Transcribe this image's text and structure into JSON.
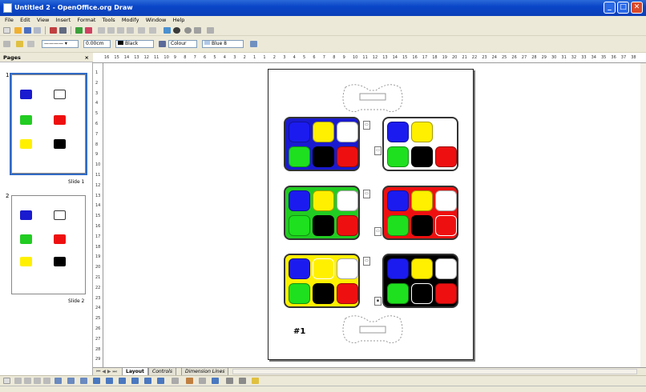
{
  "window": {
    "title": "Untitled 2 - OpenOffice.org Draw"
  },
  "menu": [
    "File",
    "Edit",
    "View",
    "Insert",
    "Format",
    "Tools",
    "Modify",
    "Window",
    "Help"
  ],
  "toolbar2": {
    "line_width": "0.00cm",
    "line_color": "Black",
    "area_style": "Colour",
    "area_color": "Blue 8"
  },
  "pages_pane": {
    "title": "Pages",
    "close": "×",
    "slide1_label": "Slide 1",
    "slide2_label": "Slide 2",
    "slide1_num": "1",
    "slide2_num": "2"
  },
  "ruler_h": [
    "16",
    "15",
    "14",
    "13",
    "12",
    "11",
    "10",
    "9",
    "8",
    "7",
    "6",
    "5",
    "4",
    "3",
    "2",
    "1",
    "1",
    "2",
    "3",
    "4",
    "5",
    "6",
    "7",
    "8",
    "9",
    "10",
    "11",
    "12",
    "13",
    "14",
    "15",
    "16",
    "17",
    "18",
    "19",
    "20",
    "21",
    "22",
    "23",
    "24",
    "25",
    "26",
    "27",
    "28",
    "29",
    "30",
    "31",
    "32",
    "33",
    "34",
    "35",
    "36",
    "37",
    "38"
  ],
  "ruler_v": [
    "1",
    "2",
    "3",
    "4",
    "5",
    "6",
    "7",
    "8",
    "9",
    "10",
    "11",
    "12",
    "13",
    "14",
    "15",
    "16",
    "17",
    "18",
    "19",
    "20",
    "21",
    "22",
    "23",
    "24",
    "25",
    "26",
    "27",
    "28",
    "29"
  ],
  "page": {
    "label": "#1"
  },
  "panels": [
    {
      "bg": "#1a1ad0",
      "cells": [
        "#1b1bf0",
        "#fff000",
        "#ffffff",
        "#1ee01e",
        "#000000",
        "#ee1010"
      ]
    },
    {
      "bg": "#ffffff",
      "cells": [
        "#1b1bf0",
        "#fff000",
        "#ffffff",
        "#1ee01e",
        "#000000",
        "#ee1010"
      ]
    },
    {
      "bg": "#22cc22",
      "cells": [
        "#1b1bf0",
        "#fff000",
        "#ffffff",
        "#1ee01e",
        "#000000",
        "#ee1010"
      ]
    },
    {
      "bg": "#ee1010",
      "cells": [
        "#1b1bf0",
        "#fff000",
        "#ffffff",
        "#1ee01e",
        "#000000",
        "#ee1010"
      ]
    },
    {
      "bg": "#fff000",
      "cells": [
        "#1b1bf0",
        "#fff000",
        "#ffffff",
        "#1ee01e",
        "#000000",
        "#ee1010"
      ]
    },
    {
      "bg": "#000000",
      "cells": [
        "#1b1bf0",
        "#fff000",
        "#ffffff",
        "#1ee01e",
        "#000000",
        "#ee1010"
      ]
    }
  ],
  "tabs": [
    "Layout",
    "Controls",
    "Dimension Lines"
  ],
  "colors": {
    "accent": "#316ac5",
    "titlebar": "#0a46c8"
  }
}
